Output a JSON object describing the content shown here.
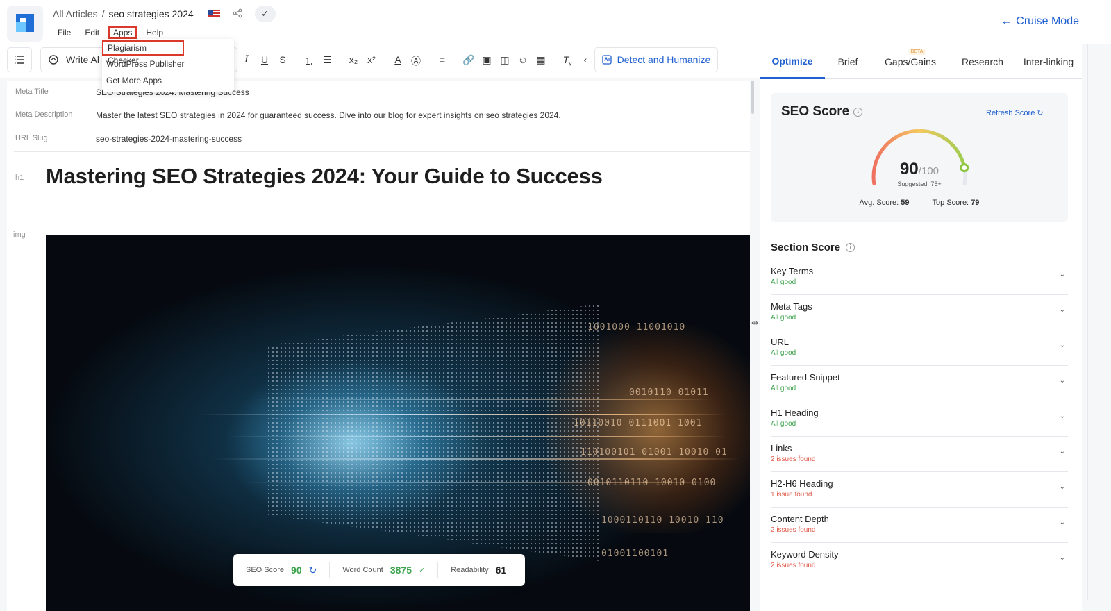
{
  "header": {
    "breadcrumb_root": "All Articles",
    "breadcrumb_sep": "/",
    "breadcrumb_current": "seo strategies 2024",
    "menus": [
      "File",
      "Edit",
      "Apps",
      "Help"
    ],
    "cruise_mode": "Cruise Mode"
  },
  "apps_menu": {
    "items": [
      "Plagiarism Checker",
      "WordPress Publisher",
      "Get More Apps"
    ]
  },
  "toolbar": {
    "write_label": "Write Al",
    "detect_label": "Detect and Humanize",
    "format_icons": [
      "italic-icon",
      "underline-icon",
      "strikethrough-icon",
      "ordered-list-icon",
      "bullet-list-icon",
      "subscript-icon",
      "superscript-icon",
      "text-color-icon",
      "highlight-icon",
      "align-icon",
      "link-icon",
      "image-icon",
      "embed-icon",
      "emoji-icon",
      "table-icon",
      "clear-format-icon",
      "collapse-icon"
    ]
  },
  "editor": {
    "meta_title_label": "Meta Title",
    "meta_title": "SEO Strategies 2024: Mastering Success",
    "meta_desc_label": "Meta Description",
    "meta_desc": "Master the latest SEO strategies in 2024 for guaranteed success. Dive into our blog for expert insights on seo strategies 2024.",
    "url_label": "URL Slug",
    "url_slug": "seo-strategies-2024-mastering-success",
    "h1_tag": "h1",
    "h1": "Mastering SEO Strategies 2024: Your Guide to Success",
    "img_tag": "img"
  },
  "stats": {
    "seo_label": "SEO Score",
    "seo_value": "90",
    "wc_label": "Word Count",
    "wc_value": "3875",
    "read_label": "Readability",
    "read_value": "61"
  },
  "panel": {
    "tabs": [
      "Optimize",
      "Brief",
      "Gaps/Gains",
      "Research",
      "Inter-linking"
    ],
    "beta_badge": "BETA",
    "seo_title": "SEO Score",
    "refresh": "Refresh Score",
    "score": "90",
    "score_max": "/100",
    "score_fraction": 0.9,
    "suggested": "Suggested: 75+",
    "avg_label": "Avg. Score:",
    "avg_value": "59",
    "top_label": "Top Score:",
    "top_value": "79",
    "section_title": "Section Score",
    "sections": [
      {
        "name": "Key Terms",
        "status": "All good"
      },
      {
        "name": "Meta Tags",
        "status": "All good"
      },
      {
        "name": "URL",
        "status": "All good"
      },
      {
        "name": "Featured Snippet",
        "status": "All good"
      },
      {
        "name": "H1 Heading",
        "status": "All good"
      },
      {
        "name": "Links",
        "status": "2 issues found"
      },
      {
        "name": "H2-H6 Heading",
        "status": "1 issue found"
      },
      {
        "name": "Content Depth",
        "status": "2 issues found"
      },
      {
        "name": "Keyword Density",
        "status": "2 issues found"
      }
    ]
  },
  "colors": {
    "accent": "#1f5fcf",
    "good": "#3aa24a",
    "bad": "#e05a4a",
    "highlight_box": "#d93a2b"
  }
}
